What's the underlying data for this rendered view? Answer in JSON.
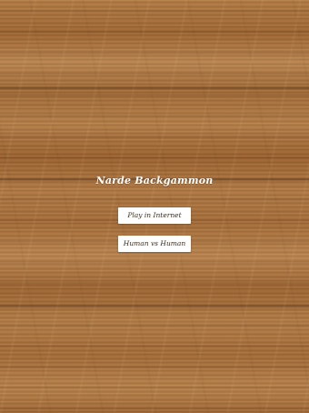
{
  "app": {
    "title": "Narde Backgammon"
  },
  "menu": {
    "buttons": [
      {
        "label": "Play in Internet"
      },
      {
        "label": "Human vs Human"
      }
    ]
  },
  "colors": {
    "wood_base": "#a9713c",
    "title_text": "#ffffff",
    "button_bg": "#ffffff",
    "button_text": "#3a2a1a"
  }
}
